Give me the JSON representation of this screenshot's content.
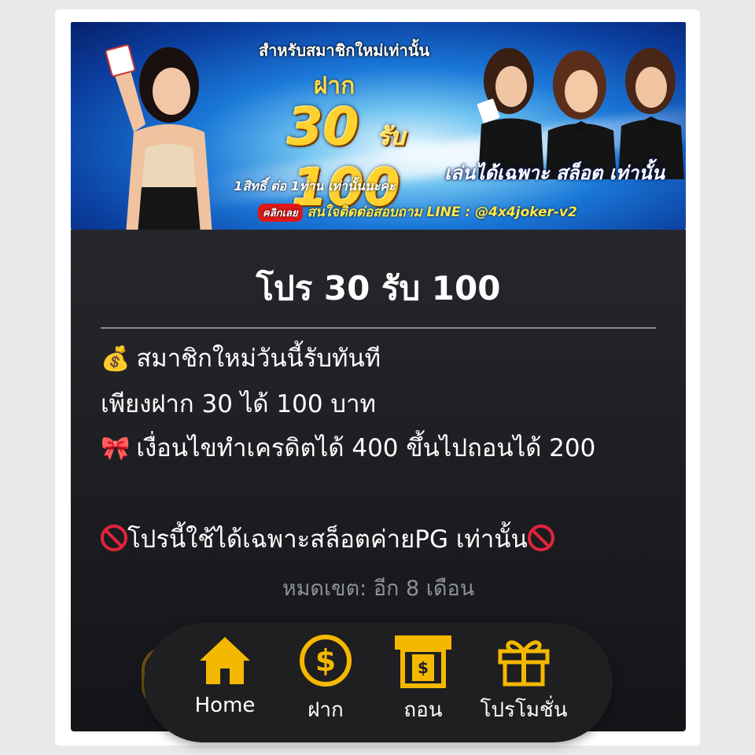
{
  "banner": {
    "headline": "สำหรับสมาชิกใหม่เท่านั้น",
    "deposit_label": "ฝาก",
    "amount_deposit": "30",
    "receive_label": "รับ",
    "amount_receive": "100",
    "slot_only": "เล่นได้เฉพาะ สล็อต เท่านั้น",
    "condition": "1สิทธิ์ ต่อ 1ท่าน เท่านั้นนะคะ",
    "click_label": "คลิกเลย",
    "contact": "สนใจติดต่อสอบถาม LINE : @4x4joker-v2"
  },
  "promo": {
    "title": "โปร 30 รับ 100",
    "line1_icon": "money-bag-icon",
    "line1": "สมาชิกใหม่วันนี้รับทันที",
    "line2": "เพียงฝาก 30 ได้ 100 บาท",
    "line3_icon": "ribbon-icon",
    "line3": "เงื่อนไขทำเครดิตได้ 400 ขึ้นไปถอนได้ 200",
    "line4": "โปรนี้ใช้ได้เฉพาะสล็อตค่ายPG เท่านั้น",
    "expiry": "หมดเขต: อีก 8 เดือน"
  },
  "nav": {
    "items": [
      {
        "label": "Home",
        "icon": "home-icon"
      },
      {
        "label": "ฝาก",
        "icon": "dollar-coin-icon"
      },
      {
        "label": "ถอน",
        "icon": "atm-withdraw-icon"
      },
      {
        "label": "โปรโมชั่น",
        "icon": "gift-icon"
      }
    ],
    "accent": "#f5b800"
  }
}
